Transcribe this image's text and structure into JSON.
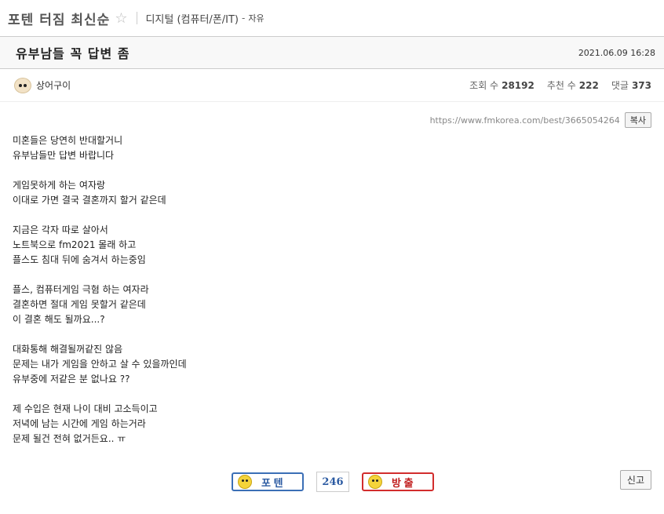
{
  "board": {
    "title": "포텐 터짐 최신순",
    "star_icon": "star-outline-icon",
    "category": "디지털 (컴퓨터/폰/IT)",
    "dash": "-",
    "subcategory": "자유"
  },
  "post": {
    "title": "유부남들 꼭 답변 좀",
    "date": "2021.06.09 16:28",
    "author": "상어구이",
    "avatar_icon": "puppy-avatar-icon"
  },
  "stats": {
    "views_label": "조회 수",
    "views": "28192",
    "likes_label": "추천 수",
    "likes": "222",
    "comments_label": "댓글",
    "comments": "373"
  },
  "share": {
    "url": "https://www.fmkorea.com/best/3665054264",
    "copy_label": "복사"
  },
  "body_lines": [
    "미혼들은 당연히 반대할거니",
    "유부남들만 답변 바랍니다",
    "",
    "게임못하게 하는 여자랑",
    "이대로 가면 결국 결혼까지 할거 같은데",
    "",
    "지금은 각자 따로 살아서",
    "노트북으로 fm2021 몰래 하고",
    "플스도 침대 뒤에 숨겨서 하는중임",
    "",
    "플스, 컴퓨터게임 극혐 하는 여자라",
    "결혼하면 절대 게임 못할거 같은데",
    "이 결혼 해도 될까요...?",
    "",
    "대화통해 해결될꺼같진 않음",
    "문제는 내가 게임을 안하고 살 수 있을까인데",
    "유부중에 저같은 분 없나요 ??",
    "",
    "제 수입은 현재 나이 대비 고소득이고",
    "저녁에 남는 시간에 게임 하는거라",
    "문제 될건 전혀 없거든요.. ㅠ"
  ],
  "votes": {
    "up_label": "포 텐",
    "count": "246",
    "down_label": "방 출",
    "up_color": "#3b6fb6",
    "down_color": "#d22d2d"
  },
  "report_label": "신고"
}
